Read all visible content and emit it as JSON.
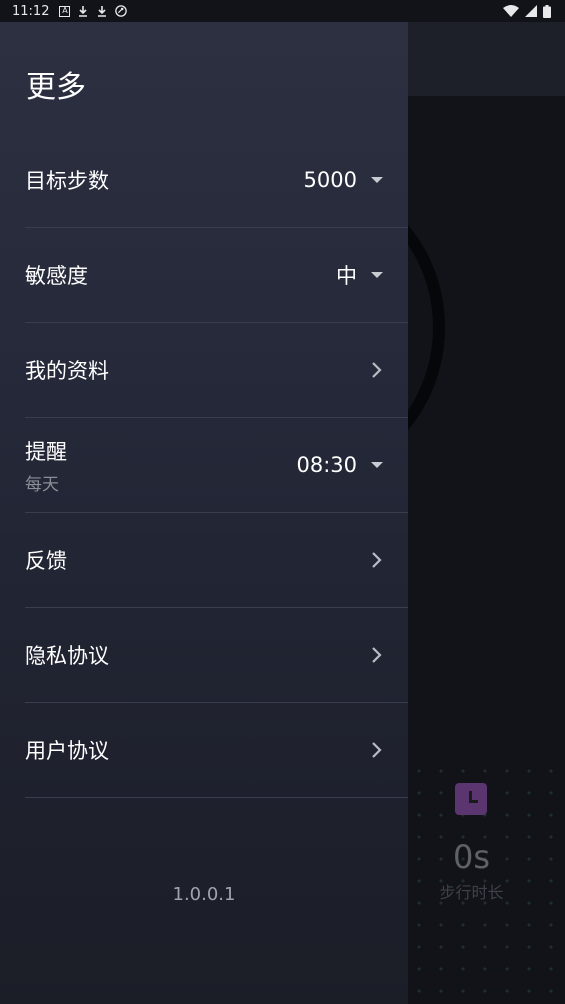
{
  "status_bar": {
    "time": "11:12",
    "left_icons": [
      "a-notification-icon",
      "download-icon",
      "download-icon",
      "vpn-icon"
    ],
    "right_icons": [
      "wifi-icon",
      "signal-icon",
      "battery-icon"
    ]
  },
  "drawer": {
    "title": "更多",
    "items": [
      {
        "label": "目标步数",
        "value": "5000",
        "control": "dropdown"
      },
      {
        "label": "敏感度",
        "value": "中",
        "control": "dropdown"
      },
      {
        "label": "我的资料",
        "control": "chevron"
      },
      {
        "label": "提醒",
        "sublabel": "每天",
        "value": "08:30",
        "control": "dropdown"
      },
      {
        "label": "反馈",
        "control": "chevron"
      },
      {
        "label": "隐私协议",
        "control": "chevron"
      },
      {
        "label": "用户协议",
        "control": "chevron"
      }
    ],
    "version": "1.0.0.1"
  },
  "background": {
    "duration_value": "0s",
    "duration_label": "步行时长",
    "accent_color": "#5a3570"
  }
}
